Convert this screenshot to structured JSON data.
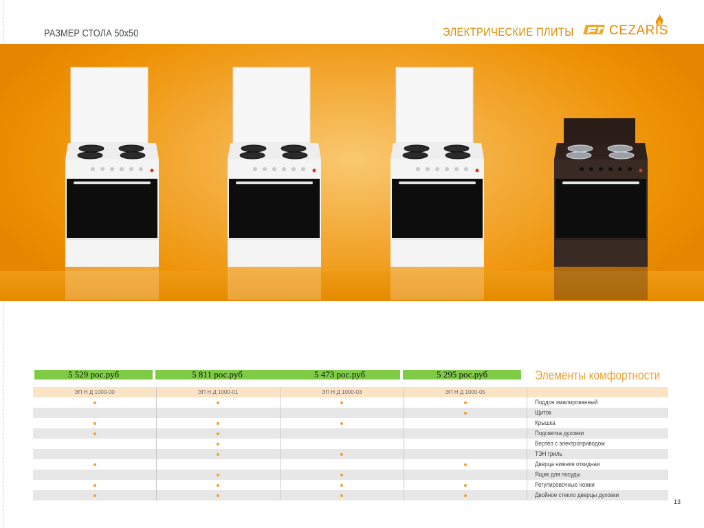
{
  "header": {
    "left_title": "РАЗМЕР СТОЛА 50x50",
    "right_title": "ЭЛЕКТРИЧЕСКИЕ ПЛИТЫ",
    "brand": "CEZARIS"
  },
  "colors": {
    "banner_orange": "#ee9205",
    "price_green": "#7ecb45",
    "accent_orange": "#e8a33c",
    "header_row": "#fbe3c6",
    "shaded_row": "#e7e7e7",
    "bullet": "#f0a030",
    "stove_white": "#f4f4f4",
    "stove_brown": "#3a2a24"
  },
  "products": [
    {
      "model": "ЭП Н Д 1000-00",
      "price": "5 529 рос.руб",
      "color": "white"
    },
    {
      "model": "ЭП Н Д 1000-01",
      "price": "5 811 рос.руб",
      "color": "white"
    },
    {
      "model": "ЭП Н Д 1000-03",
      "price": "5 473 рос.руб",
      "color": "white"
    },
    {
      "model": "ЭП Н Д 1000-05",
      "price": "5 295 рос.руб",
      "color": "brown"
    }
  ],
  "comfort": {
    "title": "Элементы комфортности",
    "features": [
      {
        "name": "Поддон эмалированный",
        "marks": [
          true,
          true,
          true,
          true
        ]
      },
      {
        "name": "Щиток",
        "marks": [
          false,
          false,
          false,
          true
        ]
      },
      {
        "name": "Крышка",
        "marks": [
          true,
          true,
          true,
          false
        ]
      },
      {
        "name": "Подсветка духовки",
        "marks": [
          true,
          true,
          false,
          false
        ]
      },
      {
        "name": "Вертел с электроприводом",
        "marks": [
          false,
          true,
          false,
          false
        ]
      },
      {
        "name": "ТЭН гриль",
        "marks": [
          false,
          true,
          true,
          false
        ]
      },
      {
        "name": "Дверца нижняя откидная",
        "marks": [
          true,
          false,
          false,
          true
        ]
      },
      {
        "name": "Ящик для посуды",
        "marks": [
          false,
          true,
          true,
          false
        ]
      },
      {
        "name": "Регулировочные ножки",
        "marks": [
          true,
          true,
          true,
          true
        ]
      },
      {
        "name": "Двойное стекло дверцы духовки",
        "marks": [
          true,
          true,
          true,
          true
        ]
      }
    ]
  },
  "page_number": "13"
}
